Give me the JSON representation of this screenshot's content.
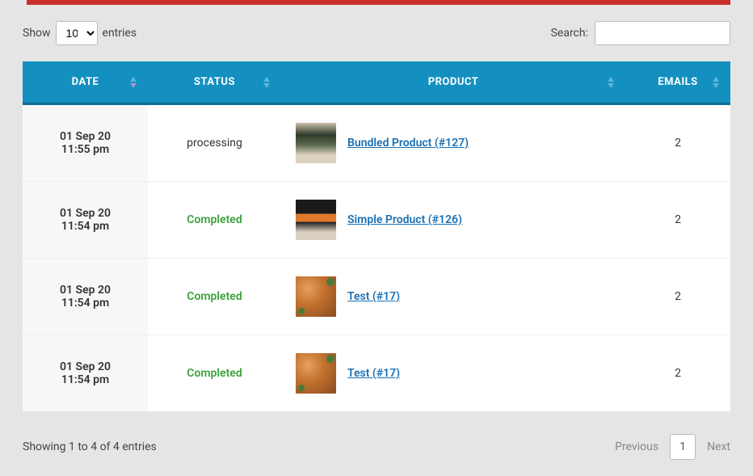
{
  "controls": {
    "show_prefix": "Show",
    "show_suffix": "entries",
    "show_value": "10",
    "search_label": "Search:",
    "search_value": ""
  },
  "columns": {
    "date": "DATE",
    "status": "STATUS",
    "product": "PRODUCT",
    "emails": "EMAILS"
  },
  "rows": [
    {
      "date_line1": "01 Sep 20",
      "date_line2": "11:55 pm",
      "status": "processing",
      "status_class": "status-processing",
      "product_name": "Bundled Product (#127)",
      "thumb_class": "thumb-bundled",
      "emails": "2"
    },
    {
      "date_line1": "01 Sep 20",
      "date_line2": "11:54 pm",
      "status": "Completed",
      "status_class": "status-completed",
      "product_name": "Simple Product (#126)",
      "thumb_class": "thumb-simple",
      "emails": "2"
    },
    {
      "date_line1": "01 Sep 20",
      "date_line2": "11:54 pm",
      "status": "Completed",
      "status_class": "status-completed",
      "product_name": "Test (#17)",
      "thumb_class": "thumb-test",
      "emails": "2"
    },
    {
      "date_line1": "01 Sep 20",
      "date_line2": "11:54 pm",
      "status": "Completed",
      "status_class": "status-completed",
      "product_name": "Test (#17)",
      "thumb_class": "thumb-test",
      "emails": "2"
    }
  ],
  "footer": {
    "info": "Showing 1 to 4 of 4 entries",
    "previous": "Previous",
    "next": "Next",
    "current_page": "1"
  }
}
